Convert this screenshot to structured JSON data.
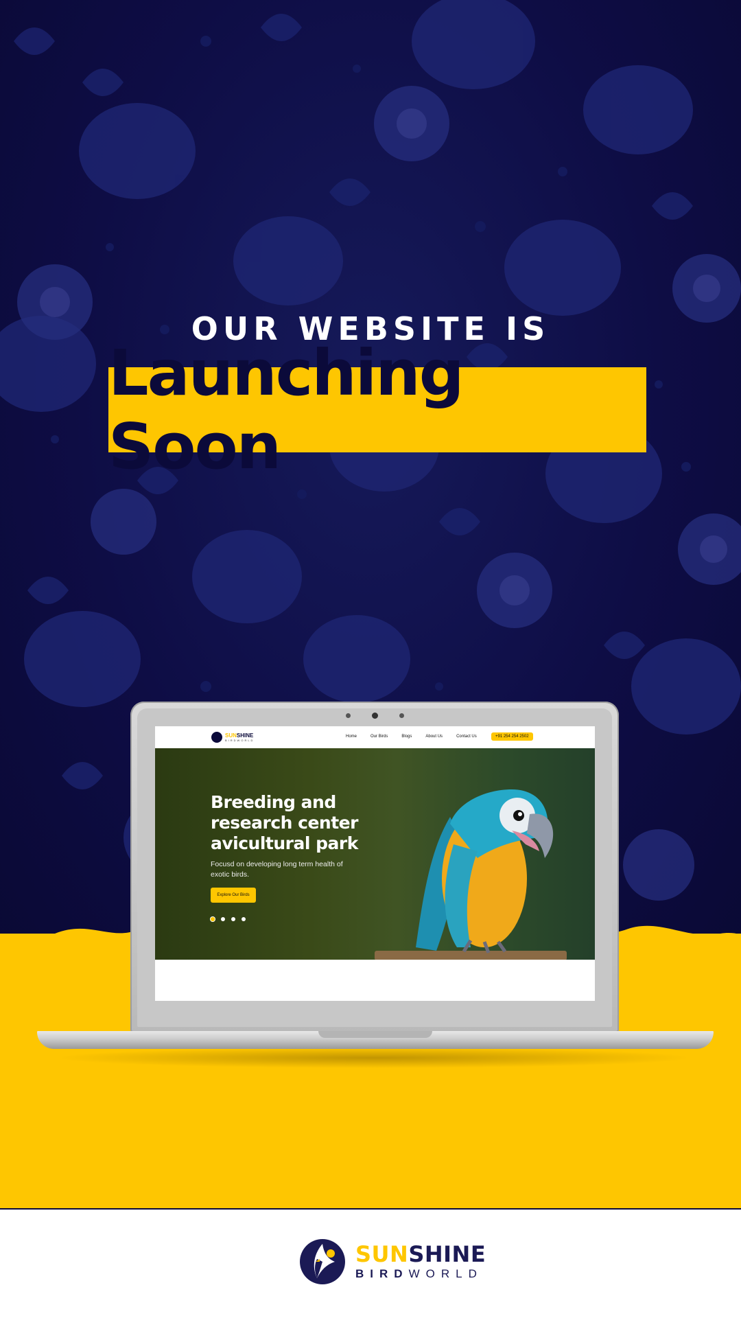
{
  "hero": {
    "subtitle": "OUR WEBSITE IS",
    "headline": "Launching Soon"
  },
  "website_preview": {
    "brand": {
      "sun": "SUN",
      "shine": "SHINE",
      "sub": "BIRDWORLD"
    },
    "nav": [
      "Home",
      "Our Birds",
      "Blogs",
      "About Us",
      "Contact Us"
    ],
    "phone": "+91 254 254 2502",
    "title": "Breeding and research center avicultural park",
    "subtitle": "Focusd on developing long term health of exotic birds.",
    "cta": "Explore Our Birds",
    "slides": 4,
    "active_slide": 1
  },
  "footer_logo": {
    "sun": "SUN",
    "shine": "SHINE",
    "bird": "BIRD",
    "world": "WORLD"
  },
  "colors": {
    "brand_yellow": "#fec601",
    "brand_navy": "#0b0a3a"
  },
  "icons": [
    "laptop-camera-icon",
    "parrot-image",
    "sunshine-bird-logo-icon"
  ]
}
